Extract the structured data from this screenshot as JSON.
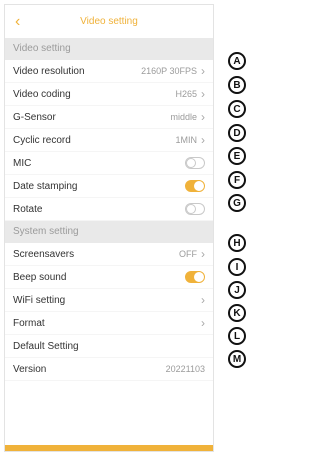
{
  "header": {
    "back_icon": "‹",
    "title": "Video setting"
  },
  "video_section": {
    "label": "Video setting",
    "rows": [
      {
        "label": "Video resolution",
        "value": "2160P 30FPS"
      },
      {
        "label": "Video coding",
        "value": "H265"
      },
      {
        "label": "G-Sensor",
        "value": "middle"
      },
      {
        "label": "Cyclic record",
        "value": "1MIN"
      },
      {
        "label": "MIC",
        "toggle": false
      },
      {
        "label": "Date stamping",
        "toggle": true
      },
      {
        "label": "Rotate",
        "toggle": false
      }
    ]
  },
  "system_section": {
    "label": "System setting",
    "rows": [
      {
        "label": "Screensavers",
        "value": "OFF"
      },
      {
        "label": "Beep sound",
        "toggle": true
      },
      {
        "label": "WiFi setting",
        "value": ""
      },
      {
        "label": "Format",
        "value": ""
      },
      {
        "label": "Default Setting",
        "value": ""
      },
      {
        "label": "Version",
        "value": "20221103"
      }
    ]
  },
  "markers": [
    "A",
    "B",
    "C",
    "D",
    "E",
    "F",
    "G",
    "H",
    "I",
    "J",
    "K",
    "L",
    "M"
  ],
  "colors": {
    "accent": "#f0b23a",
    "section_bg": "#e9e9e9"
  }
}
